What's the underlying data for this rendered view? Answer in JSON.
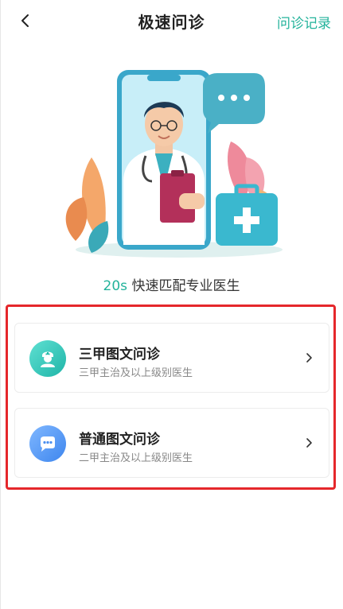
{
  "header": {
    "title": "极速问诊",
    "records_link": "问诊记录"
  },
  "hero": {
    "tagline_accent": "20s",
    "tagline_text": " 快速匹配专业医生"
  },
  "consult_options": [
    {
      "title": "三甲图文问诊",
      "subtitle": "三甲主治及以上级别医生",
      "icon": "nurse-icon",
      "color": "#23b9ab"
    },
    {
      "title": "普通图文问诊",
      "subtitle": "二甲主治及以上级别医生",
      "icon": "chat-bubble-icon",
      "color": "#4a8ff0"
    }
  ],
  "colors": {
    "accent": "#23b39b",
    "highlight": "#e5272b"
  }
}
